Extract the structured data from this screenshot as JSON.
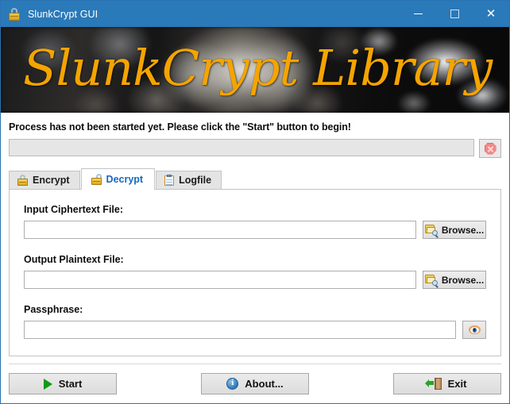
{
  "window": {
    "title": "SlunkCrypt GUI",
    "icon": "padlock-icon",
    "accent_color": "#2a79b9",
    "controls": {
      "minimize": "–",
      "maximize": "□",
      "close": "✕"
    }
  },
  "banner": {
    "title": "SlunkCrypt Library",
    "title_color": "#f5a400",
    "background": "blurred dark photograph of a combination safe lock dial"
  },
  "status": {
    "message": "Process has not been started yet. Please click the \"Start\" button to begin!",
    "progress_percent": 0,
    "stop_button": {
      "icon": "stop-octagon-x-icon",
      "enabled": false,
      "color": "#f48787"
    }
  },
  "tabs": [
    {
      "label": "Encrypt",
      "icon": "padlock-closed-icon",
      "active": false
    },
    {
      "label": "Decrypt",
      "icon": "padlock-open-icon",
      "active": true
    },
    {
      "label": "Logfile",
      "icon": "clipboard-icon",
      "active": false
    }
  ],
  "tab_active_text_color": "#1668c1",
  "form": {
    "fields": [
      {
        "label": "Input Ciphertext File:",
        "value": "",
        "placeholder": "",
        "button": {
          "label": "Browse...",
          "icon": "folder-search-icon"
        }
      },
      {
        "label": "Output Plaintext File:",
        "value": "",
        "placeholder": "",
        "button": {
          "label": "Browse...",
          "icon": "folder-search-icon"
        }
      }
    ],
    "passphrase": {
      "label": "Passphrase:",
      "value": "",
      "placeholder": "",
      "reveal_button": {
        "icon": "eye-icon",
        "label": ""
      }
    }
  },
  "footer": {
    "buttons": [
      {
        "label": "Start",
        "icon": "play-triangle-icon"
      },
      {
        "label": "About...",
        "icon": "info-circle-icon"
      },
      {
        "label": "Exit",
        "icon": "exit-door-icon"
      }
    ]
  }
}
